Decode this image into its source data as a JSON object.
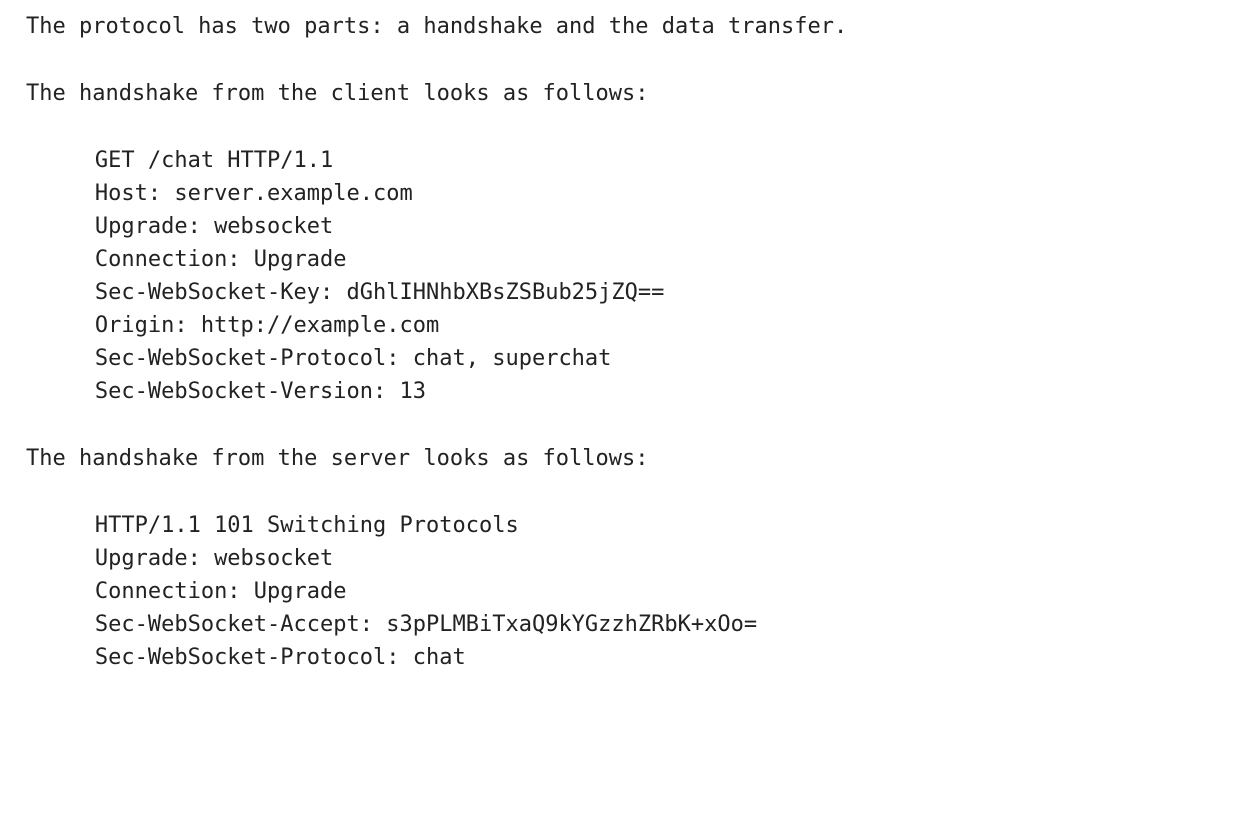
{
  "intro": "The protocol has two parts: a handshake and the data transfer.",
  "client": {
    "lead": "The handshake from the client looks as follows:",
    "lines": [
      "GET /chat HTTP/1.1",
      "Host: server.example.com",
      "Upgrade: websocket",
      "Connection: Upgrade",
      "Sec-WebSocket-Key: dGhlIHNhbXBsZSBub25jZQ==",
      "Origin: http://example.com",
      "Sec-WebSocket-Protocol: chat, superchat",
      "Sec-WebSocket-Version: 13"
    ]
  },
  "server": {
    "lead": "The handshake from the server looks as follows:",
    "lines": [
      "HTTP/1.1 101 Switching Protocols",
      "Upgrade: websocket",
      "Connection: Upgrade",
      "Sec-WebSocket-Accept: s3pPLMBiTxaQ9kYGzzhZRbK+xOo=",
      "Sec-WebSocket-Protocol: chat"
    ]
  }
}
